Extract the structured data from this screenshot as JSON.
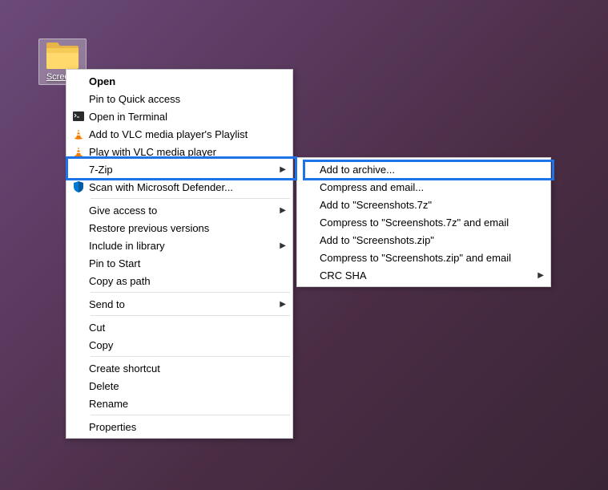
{
  "desktop": {
    "folder_label": "Screens"
  },
  "main_menu": {
    "open": "Open",
    "pin_quick": "Pin to Quick access",
    "open_terminal": "Open in Terminal",
    "vlc_add": "Add to VLC media player's Playlist",
    "vlc_play": "Play with VLC media player",
    "seven_zip": "7-Zip",
    "scan_defender": "Scan with Microsoft Defender...",
    "give_access": "Give access to",
    "restore_prev": "Restore previous versions",
    "include_lib": "Include in library",
    "pin_start": "Pin to Start",
    "copy_path": "Copy as path",
    "send_to": "Send to",
    "cut": "Cut",
    "copy": "Copy",
    "create_shortcut": "Create shortcut",
    "delete": "Delete",
    "rename": "Rename",
    "properties": "Properties"
  },
  "sub_menu": {
    "add_archive": "Add to archive...",
    "compress_email": "Compress and email...",
    "add_7z": "Add to \"Screenshots.7z\"",
    "compress_7z_email": "Compress to \"Screenshots.7z\" and email",
    "add_zip": "Add to \"Screenshots.zip\"",
    "compress_zip_email": "Compress to \"Screenshots.zip\" and email",
    "crc_sha": "CRC SHA"
  }
}
